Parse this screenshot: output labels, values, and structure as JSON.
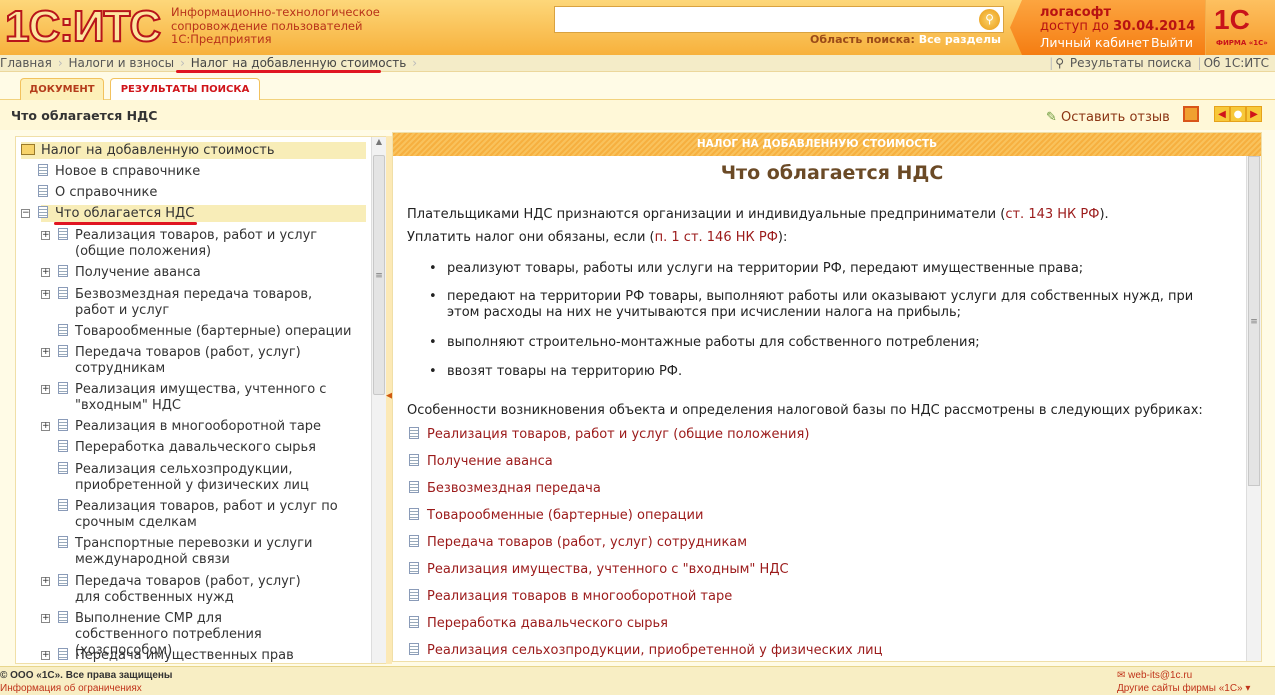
{
  "header": {
    "logo": "1С:ИТС",
    "tagline": [
      "Информационно-технологическое",
      "сопровождение пользователей",
      "1С:Предприятия"
    ],
    "search": {
      "value": "",
      "scope_label": "Область поиска:",
      "scope_value": "Все разделы"
    },
    "user": {
      "name": "логасофт",
      "access_prefix": "доступ до",
      "access_date": "30.04.2014",
      "cabinet": "Личный кабинет",
      "logout": "Выйти"
    },
    "firm_logo": "1С",
    "firm_caption": "ФИРМА «1С»"
  },
  "breadcrumb": [
    "Главная",
    "Налоги и взносы",
    "Налог на добавленную стоимость"
  ],
  "topright": {
    "search_results": "Результаты поиска",
    "about": "Об 1С:ИТС"
  },
  "tabs": [
    "ДОКУМЕНТ",
    "РЕЗУЛЬТАТЫ ПОИСКА"
  ],
  "page_title": "Что облагается НДС",
  "toolbar": {
    "feedback": "Оставить отзыв"
  },
  "tree": [
    {
      "label": "Налог на добавленную стоимость"
    },
    {
      "label": "Новое в справочнике"
    },
    {
      "label": "О справочнике"
    },
    {
      "label": "Что облагается НДС"
    },
    {
      "label": "Реализация товаров, работ и услуг (общие положения)"
    },
    {
      "label": "Получение аванса"
    },
    {
      "label": "Безвозмездная передача товаров, работ и услуг"
    },
    {
      "label": "Товарообменные (бартерные) операции"
    },
    {
      "label": "Передача товаров (работ, услуг) сотрудникам"
    },
    {
      "label": "Реализация имущества, учтенного с \"входным\" НДС"
    },
    {
      "label": "Реализация в многооборотной таре"
    },
    {
      "label": "Переработка давальческого сырья"
    },
    {
      "label": "Реализация сельхозпродукции, приобретенной у физических лиц"
    },
    {
      "label": "Реализация товаров, работ и услуг по срочным сделкам"
    },
    {
      "label": "Транспортные перевозки и услуги международной связи"
    },
    {
      "label": "Передача товаров (работ, услуг) для собственных нужд"
    },
    {
      "label": "Выполнение СМР для собственного потребления (хозспособом)"
    },
    {
      "label": "Передача имущественных прав"
    }
  ],
  "doc": {
    "banner": "НАЛОГ НА ДОБАВЛЕННУЮ СТОИМОСТЬ",
    "title": "Что облагается НДС",
    "p1": "Плательщиками НДС признаются организации и индивидуальные предприниматели (",
    "p1_link": "ст. 143 НК РФ",
    "p1_end": ").",
    "p2": "Уплатить налог они обязаны, если (",
    "p2_link": "п. 1 ст. 146 НК РФ",
    "p2_end": "):",
    "bullets": [
      "реализуют товары, работы или услуги на территории РФ, передают имущественные права;",
      "передают на территории РФ товары, выполняют работы или оказывают услуги для собственных нужд, при этом расходы на них не учитываются при исчислении налога на прибыль;",
      "выполняют строительно-монтажные работы для собственного потребления;",
      "ввозят товары на территорию РФ."
    ],
    "p3": "Особенности возникновения объекта и определения налоговой базы по НДС рассмотрены в следующих рубриках:",
    "links": [
      "Реализация товаров, работ и услуг (общие положения)",
      "Получение аванса",
      "Безвозмездная передача",
      "Товарообменные (бартерные) операции",
      "Передача товаров (работ, услуг) сотрудникам",
      "Реализация имущества, учтенного с \"входным\" НДС",
      "Реализация товаров в многооборотной таре",
      "Переработка давальческого сырья",
      "Реализация сельхозпродукции, приобретенной у физических лиц"
    ]
  },
  "footer": {
    "copyright": "© ООО «1С». Все права защищены",
    "restrictions": "Информация об ограничениях",
    "email": "web-its@1c.ru",
    "other_sites": "Другие сайты фирмы «1С» ▾"
  }
}
